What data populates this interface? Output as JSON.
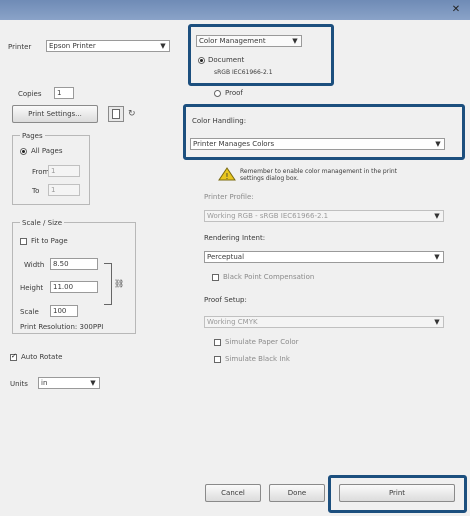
{
  "window": {
    "close_glyph": "✕"
  },
  "left": {
    "printer_label": "Printer",
    "printer_value": "Epson Printer",
    "copies_label": "Copies",
    "copies_value": "1",
    "print_settings_button": "Print Settings...",
    "pages_group": "Pages",
    "all_pages_label": "All Pages",
    "from_label": "From",
    "from_value": "1",
    "to_label": "To",
    "to_value": "1",
    "scale_group": "Scale / Size",
    "fit_to_page_label": "Fit to Page",
    "width_label": "Width",
    "width_value": "8.50",
    "height_label": "Height",
    "height_value": "11.00",
    "scale_label": "Scale",
    "scale_value": "100",
    "scale_note": "Print Resolution: 300PPI",
    "auto_rotate_label": "Auto Rotate",
    "units_label": "Units",
    "units_value": "in"
  },
  "right": {
    "color_handling_label": "Color Management",
    "document_label": "Document",
    "document_profile": "sRGB IEC61966-2.1",
    "proof_label": "Proof",
    "color_handling_field_label": "Color Handling:",
    "color_handling_value": "Printer Manages Colors",
    "warning_text": "Remember to enable color management in the print settings dialog box.",
    "printer_profile_label": "Printer Profile:",
    "printer_profile_value": "Working RGB - sRGB IEC61966-2.1",
    "rendering_intent_label": "Rendering Intent:",
    "rendering_intent_value": "Perceptual",
    "black_point_label": "Black Point Compensation",
    "proof_setup_label": "Proof Setup:",
    "proof_setup_value": "Working CMYK",
    "simulate_paper_label": "Simulate Paper Color",
    "simulate_black_label": "Simulate Black Ink"
  },
  "footer": {
    "cancel_button": "Cancel",
    "done_button": "Done",
    "print_button": "Print"
  },
  "colors": {
    "title_bar": "#7a95bd",
    "callout": "#1c4f7e",
    "warning": "#e8c620"
  }
}
